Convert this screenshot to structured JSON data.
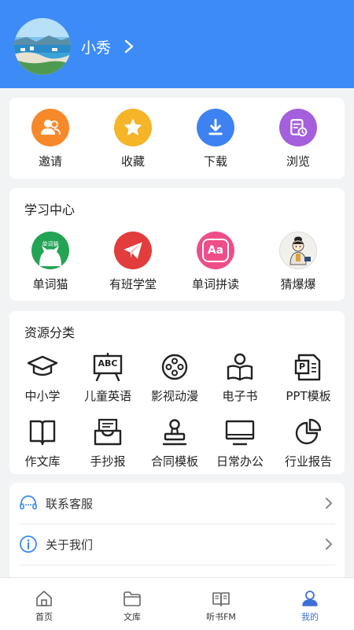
{
  "profile": {
    "username": "小秀"
  },
  "quick_actions": [
    {
      "label": "邀请",
      "icon": "people-icon",
      "color": "#f7892b"
    },
    {
      "label": "收藏",
      "icon": "star-icon",
      "color": "#f6b429"
    },
    {
      "label": "下载",
      "icon": "download-icon",
      "color": "#3d82f0"
    },
    {
      "label": "浏览",
      "icon": "history-icon",
      "color": "#a45fdc"
    }
  ],
  "learning_center": {
    "title": "学习中心",
    "items": [
      {
        "label": "单词猫",
        "icon": "word-cat-app-icon",
        "badge_text": "单词猫"
      },
      {
        "label": "有班学堂",
        "icon": "paper-plane-app-icon"
      },
      {
        "label": "单词拼读",
        "icon": "aa-app-icon",
        "badge_text": "Aa"
      },
      {
        "label": "猜爆爆",
        "icon": "cartoon-character-app-icon"
      }
    ]
  },
  "resources": {
    "title": "资源分类",
    "items": [
      {
        "label": "中小学",
        "icon": "graduation-cap-icon"
      },
      {
        "label": "儿童英语",
        "icon": "abc-board-icon",
        "badge_text": "ABC"
      },
      {
        "label": "影视动漫",
        "icon": "film-reel-icon"
      },
      {
        "label": "电子书",
        "icon": "reader-icon"
      },
      {
        "label": "PPT模板",
        "icon": "ppt-file-icon",
        "badge_text": "P"
      },
      {
        "label": "作文库",
        "icon": "open-book-icon"
      },
      {
        "label": "手抄报",
        "icon": "inbox-tray-icon"
      },
      {
        "label": "合同模板",
        "icon": "stamp-icon"
      },
      {
        "label": "日常办公",
        "icon": "monitor-icon"
      },
      {
        "label": "行业报告",
        "icon": "pie-chart-icon"
      }
    ]
  },
  "menu": [
    {
      "label": "联系客服",
      "icon": "headset-icon"
    },
    {
      "label": "关于我们",
      "icon": "info-icon"
    }
  ],
  "tabbar": [
    {
      "label": "首页",
      "icon": "home-icon"
    },
    {
      "label": "文库",
      "icon": "folder-icon"
    },
    {
      "label": "听书FM",
      "icon": "book-icon"
    },
    {
      "label": "我的",
      "icon": "user-icon",
      "active": true
    }
  ]
}
